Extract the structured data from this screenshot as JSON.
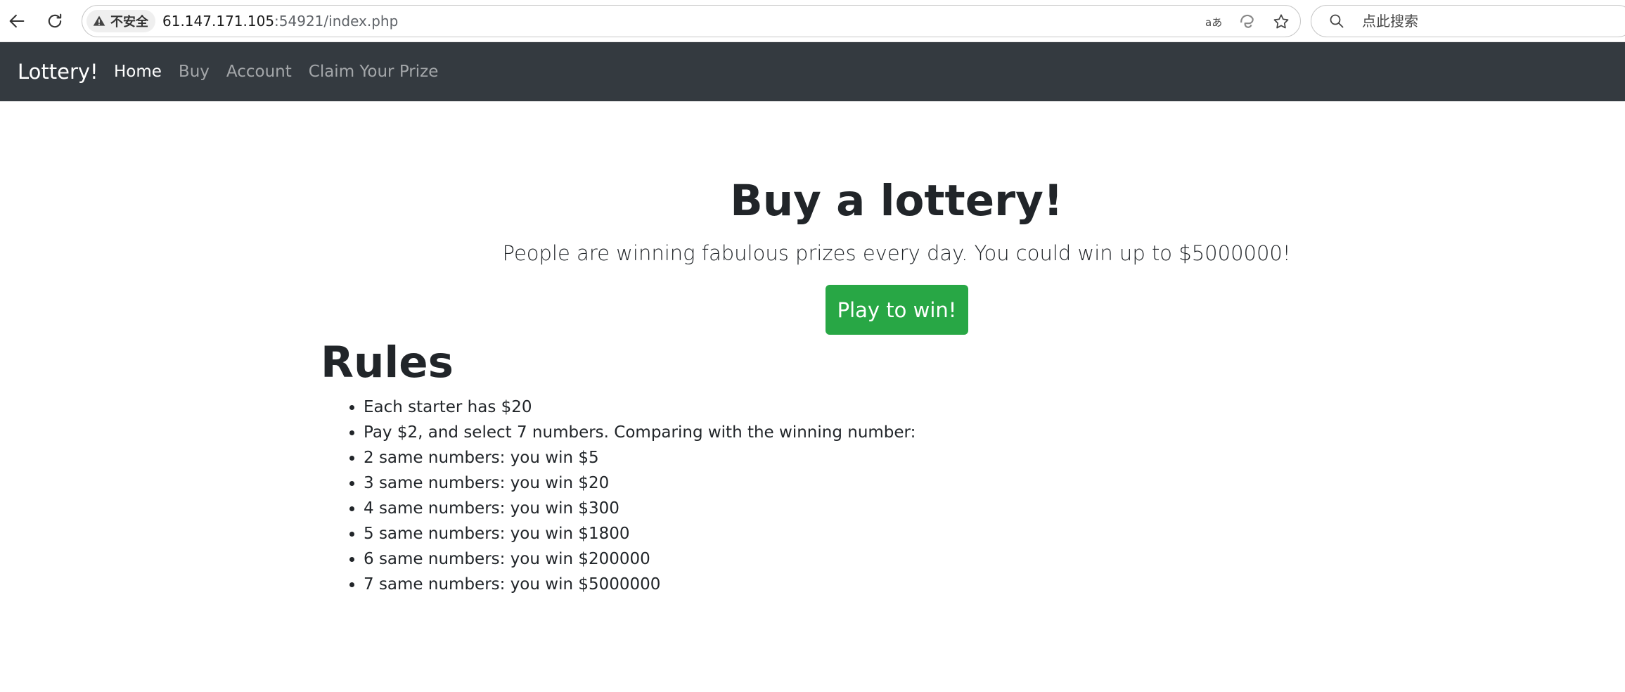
{
  "browser": {
    "security_label": "不安全",
    "url_host": "61.147.171.105",
    "url_rest": ":54921/index.php",
    "search_placeholder": "点此搜索",
    "icons": [
      "back-arrow-icon",
      "reload-icon",
      "warning-icon",
      "read-aloud-icon",
      "edge-icon",
      "star-icon",
      "search-icon"
    ]
  },
  "navbar": {
    "brand": "Lottery!",
    "links": [
      {
        "label": "Home",
        "active": true
      },
      {
        "label": "Buy",
        "active": false
      },
      {
        "label": "Account",
        "active": false
      },
      {
        "label": "Claim Your Prize",
        "active": false
      }
    ],
    "background_color": "#343a40"
  },
  "hero": {
    "title": "Buy a lottery!",
    "lead": "People are winning fabulous prizes every day. You could win up to $5000000!",
    "button_label": "Play to win!",
    "button_color": "#28a745"
  },
  "rules": {
    "title": "Rules",
    "items": [
      "Each starter has $20",
      "Pay $2, and select 7 numbers. Comparing with the winning number:",
      "2 same numbers: you win $5",
      "3 same numbers: you win $20",
      "4 same numbers: you win $300",
      "5 same numbers: you win $1800",
      "6 same numbers: you win $200000",
      "7 same numbers: you win $5000000"
    ]
  }
}
